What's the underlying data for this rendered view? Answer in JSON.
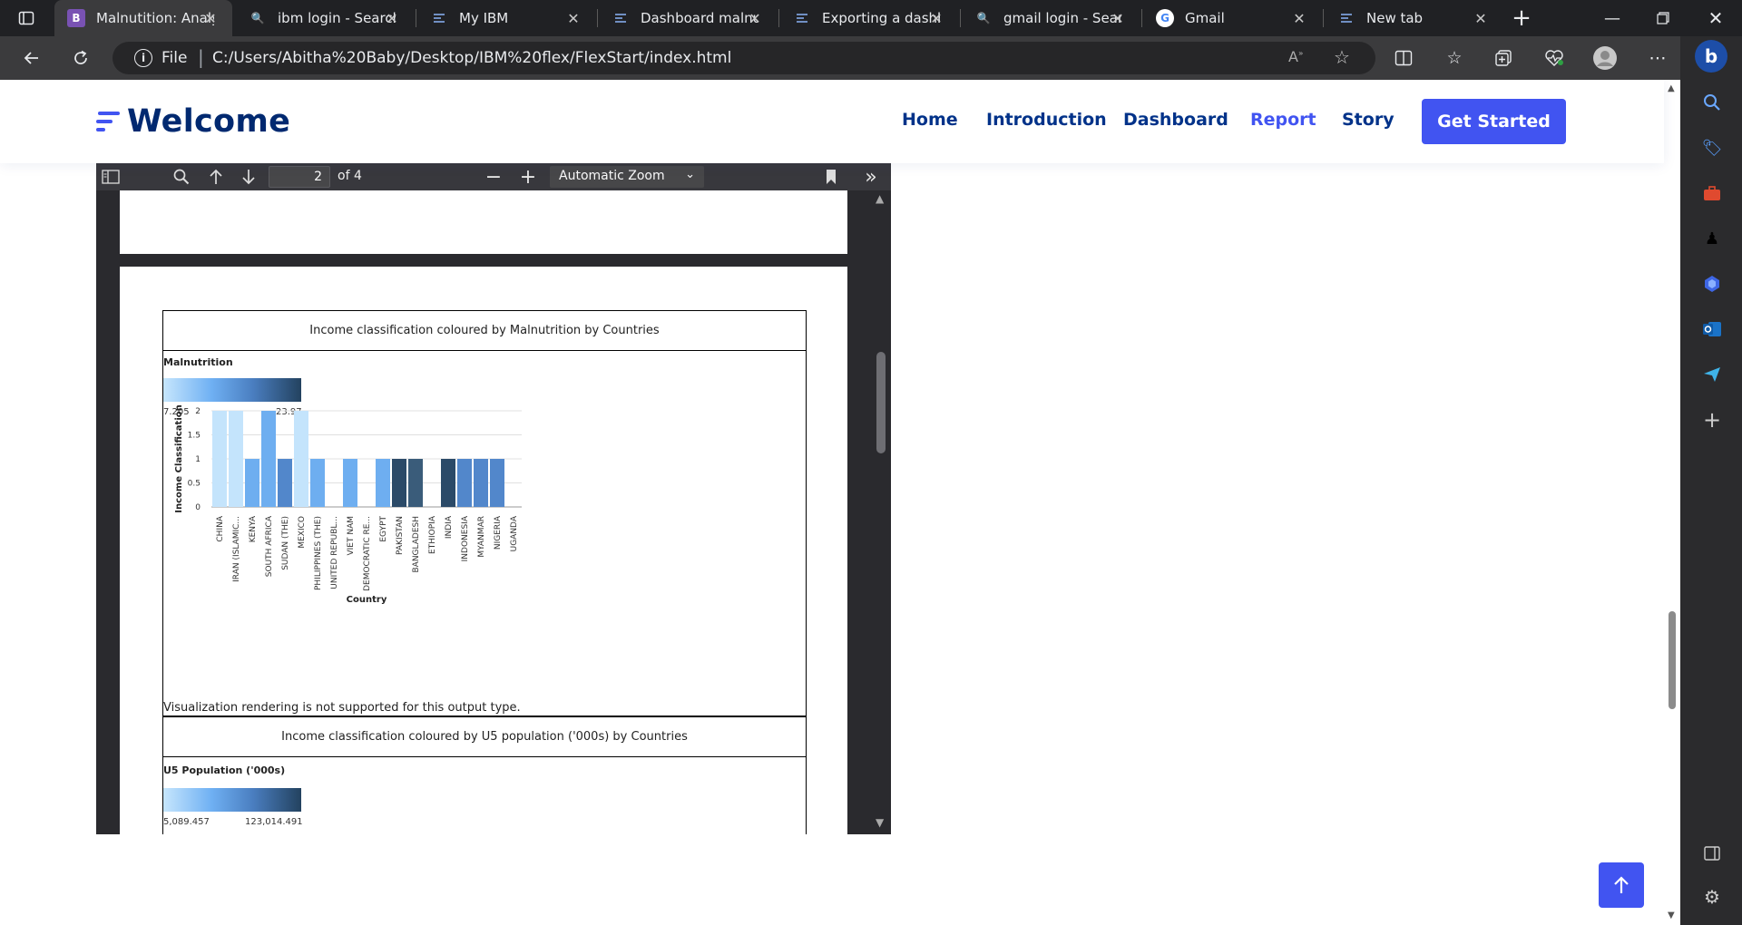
{
  "browser": {
    "tabs": [
      {
        "title": "Malnutition: Analy",
        "icon": "bootstrap-icon",
        "fav": "B",
        "fav_color": "#7952b3"
      },
      {
        "title": "ibm login - Search",
        "icon": "search-icon",
        "fav": "🔍",
        "fav_color": "transparent"
      },
      {
        "title": "My IBM",
        "icon": "ibm-icon",
        "fav": "",
        "fav_color": "transparent"
      },
      {
        "title": "Dashboard malnu",
        "icon": "ibm-cognos-icon",
        "fav": "",
        "fav_color": "transparent"
      },
      {
        "title": "Exporting a dashb",
        "icon": "ibm-docs-icon",
        "fav": "",
        "fav_color": "transparent"
      },
      {
        "title": "gmail login - Sear",
        "icon": "search-icon",
        "fav": "🔍",
        "fav_color": "transparent"
      },
      {
        "title": "Gmail",
        "icon": "google-icon",
        "fav": "G",
        "fav_color": "#ffffff"
      },
      {
        "title": "New tab",
        "icon": "new-tab-icon",
        "fav": "",
        "fav_color": "transparent"
      }
    ],
    "address": {
      "scheme": "File",
      "url": "C:/Users/Abitha%20Baby/Desktop/IBM%20flex/FlexStart/index.html"
    }
  },
  "site": {
    "logo": "Welcome",
    "nav": [
      "Home",
      "Introduction",
      "Dashboard",
      "Report",
      "Story"
    ],
    "active_nav": "Report",
    "cta": "Get Started",
    "brand_color": "#4154f1",
    "nav_color": "#013289"
  },
  "pdf_viewer": {
    "page_number": "2",
    "page_count": "of 4",
    "zoom": "Automatic Zoom"
  },
  "report": {
    "chart1_title": "Income classification coloured by Malnutrition by Countries",
    "legend1_title": "Malnutrition",
    "legend1_min": "7.205",
    "legend1_max": "23.97",
    "unsupported_note": "Visualization rendering is not supported for this output type.",
    "chart2_title": "Income classification coloured by U5 population ('000s) by Countries",
    "legend2_title": "U5 Population ('000s)",
    "legend2_min": "5,089.457",
    "legend2_max": "123,014.491"
  },
  "chart_data": {
    "type": "bar",
    "title": "Income classification coloured by Malnutrition by Countries",
    "xlabel": "Country",
    "ylabel": "Income Classification",
    "ylim": [
      0,
      2
    ],
    "yticks": [
      "0",
      "0.5",
      "1",
      "1.5",
      "2"
    ],
    "categories": [
      "CHINA",
      "IRAN (ISLAMIC...",
      "KENYA",
      "SOUTH AFRICA",
      "SUDAN (THE)",
      "MEXICO",
      "PHILIPPINES (THE)",
      "UNITED REPUBL...",
      "VIET NAM",
      "DEMOCRATIC RE...",
      "EGYPT",
      "PAKISTAN",
      "BANGLADESH",
      "ETHIOPIA",
      "INDIA",
      "INDONESIA",
      "MYANMAR",
      "NIGERIA",
      "UGANDA"
    ],
    "values": [
      2,
      2,
      1,
      2,
      1,
      2,
      1,
      0,
      1,
      0,
      1,
      1,
      1,
      0,
      1,
      1,
      1,
      1,
      0
    ],
    "colors": [
      "#c4e4fc",
      "#c4e4fc",
      "#6eaef0",
      "#6eaef0",
      "#5287cb",
      "#c4e4fc",
      "#6eaef0",
      "#6eaef0",
      "#6eaef0",
      "#6eaef0",
      "#6eaef0",
      "#2b4a68",
      "#3a5c7a",
      "#6eaef0",
      "#2b4a68",
      "#5287cb",
      "#5287cb",
      "#5287cb",
      "#6eaef0"
    ],
    "grid": true
  }
}
